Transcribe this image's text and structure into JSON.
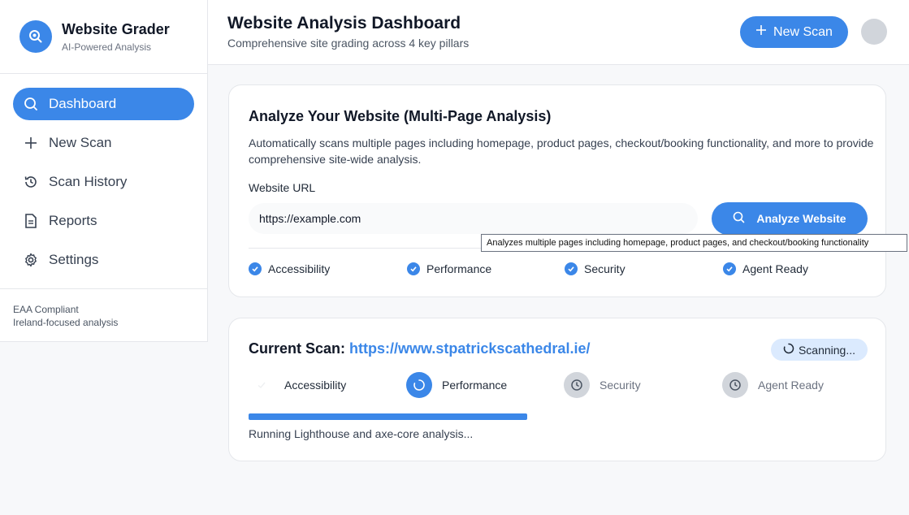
{
  "brand": {
    "title": "Website Grader",
    "subtitle": "AI-Powered Analysis"
  },
  "sidebar": {
    "items": [
      {
        "label": "Dashboard",
        "icon": "search-icon",
        "active": true
      },
      {
        "label": "New Scan",
        "icon": "plus-icon",
        "active": false
      },
      {
        "label": "Scan History",
        "icon": "history-icon",
        "active": false
      },
      {
        "label": "Reports",
        "icon": "document-icon",
        "active": false
      },
      {
        "label": "Settings",
        "icon": "gear-icon",
        "active": false
      }
    ],
    "footer": {
      "line1": "EAA Compliant",
      "line2": "Ireland-focused analysis"
    }
  },
  "header": {
    "title": "Website Analysis Dashboard",
    "subtitle": "Comprehensive site grading across 4 key pillars",
    "new_scan_label": "New Scan"
  },
  "analyze": {
    "title": "Analyze Your Website (Multi-Page Analysis)",
    "description": "Automatically scans multiple pages including homepage, product pages, checkout/booking functionality, and more to provide comprehensive site-wide analysis.",
    "url_label": "Website URL",
    "url_value": "https://example.com",
    "button_label": "Analyze Website",
    "tooltip": "Analyzes multiple pages including homepage, product pages, and checkout/booking functionality",
    "pillars": [
      "Accessibility",
      "Performance",
      "Security",
      "Agent Ready"
    ]
  },
  "current_scan": {
    "title_prefix": "Current Scan:",
    "url": "https://www.stpatrickscathedral.ie/",
    "badge": "Scanning...",
    "steps": [
      {
        "label": "Accessibility",
        "state": "done"
      },
      {
        "label": "Performance",
        "state": "active"
      },
      {
        "label": "Security",
        "state": "pending"
      },
      {
        "label": "Agent Ready",
        "state": "pending"
      }
    ],
    "progress": 1,
    "status_text": "Running Lighthouse and axe-core analysis..."
  },
  "colors": {
    "accent": "#3b87e8",
    "pending": "#d1d5db"
  }
}
